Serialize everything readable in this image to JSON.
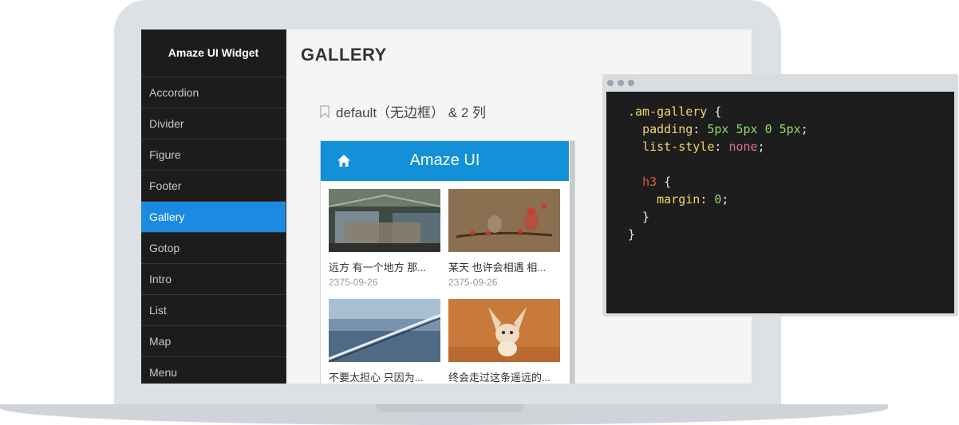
{
  "sidebar": {
    "title": "Amaze UI Widget",
    "items": [
      {
        "label": "Accordion"
      },
      {
        "label": "Divider"
      },
      {
        "label": "Figure"
      },
      {
        "label": "Footer"
      },
      {
        "label": "Gallery",
        "active": true
      },
      {
        "label": "Gotop"
      },
      {
        "label": "Intro"
      },
      {
        "label": "List"
      },
      {
        "label": "Map"
      },
      {
        "label": "Menu"
      }
    ]
  },
  "main": {
    "title": "GALLERY",
    "section_label": "default（无边框） & 2 列"
  },
  "phone": {
    "header_title": "Amaze UI",
    "items": [
      {
        "caption": "远方 有一个地方 那...",
        "date": "2375-09-26"
      },
      {
        "caption": "某天 也许会相遇 相...",
        "date": "2375-09-26"
      },
      {
        "caption": "不要太担心 只因为...",
        "date": ""
      },
      {
        "caption": "终会走过这条遥远的...",
        "date": ""
      }
    ]
  },
  "code": {
    "line1_selector": ".am-gallery",
    "line1_brace": " {",
    "line2_prop": "padding",
    "line2_value": "5px 5px 0 5px",
    "line3_prop": "list-style",
    "line3_value": "none",
    "line5_tag": "h3",
    "line5_brace": " {",
    "line6_prop": "margin",
    "line6_value": "0"
  },
  "colors": {
    "accent": "#1a8be0",
    "phone_header": "#1290d8",
    "sidebar_bg": "#1c1c1c",
    "code_bg": "#1d1d1d"
  }
}
